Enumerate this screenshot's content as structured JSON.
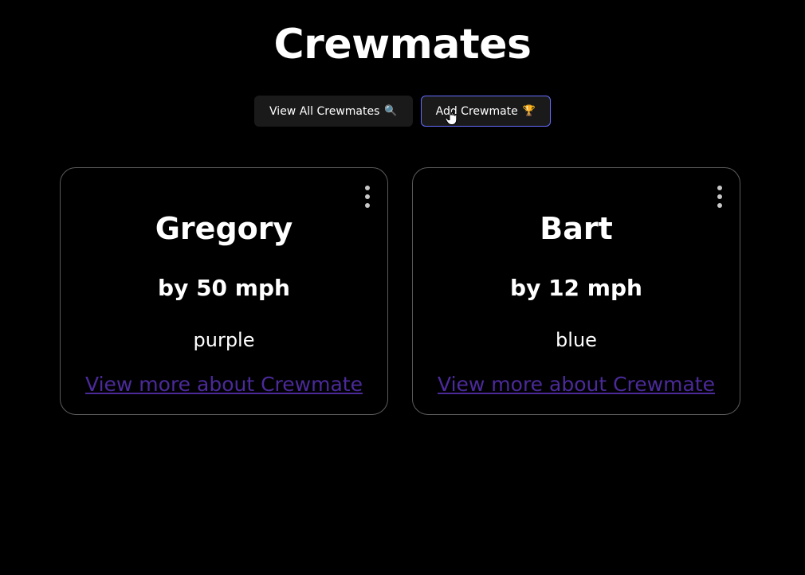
{
  "header": {
    "title": "Crewmates"
  },
  "nav": {
    "view_all_label": "View All Crewmates",
    "view_all_icon": "magnifying-glass-icon",
    "view_all_glyph": "🔍",
    "add_label": "Add Crewmate",
    "add_icon": "trophy-icon",
    "add_glyph": "🏆",
    "active_border_color": "#646cff"
  },
  "crewmates": [
    {
      "name": "Gregory",
      "speed": "by 50 mph",
      "color": "purple",
      "link_text": "View more about Crewmate"
    },
    {
      "name": "Bart",
      "speed": "by 12 mph",
      "color": "blue",
      "link_text": "View more about Crewmate"
    }
  ],
  "colors": {
    "background": "#000000",
    "card_border": "#5a5a5a",
    "link": "#4b2a9a"
  }
}
